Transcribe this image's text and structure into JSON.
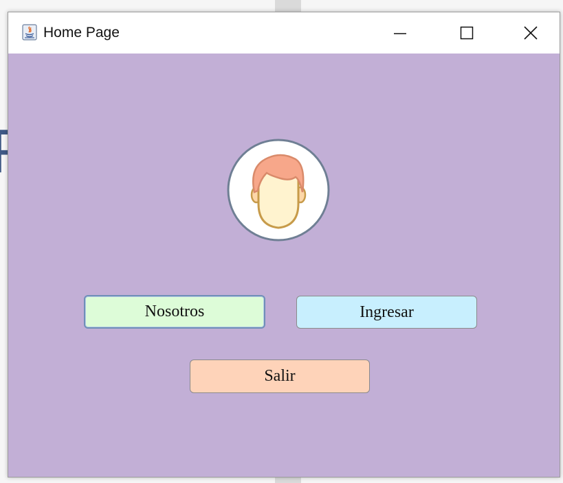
{
  "window": {
    "title": "Home Page"
  },
  "title_controls": {
    "minimize": "minimize-icon",
    "maximize": "maximize-icon",
    "close": "close-icon"
  },
  "main": {
    "avatar_icon": "user-face-icon",
    "buttons": {
      "nosotros": "Nosotros",
      "ingresar": "Ingresar",
      "salir": "Salir"
    }
  },
  "colors": {
    "window_background": "#c2afd6",
    "nosotros_bg": "#ddfcd8",
    "ingresar_bg": "#c8effe",
    "salir_bg": "#fed3b9"
  }
}
